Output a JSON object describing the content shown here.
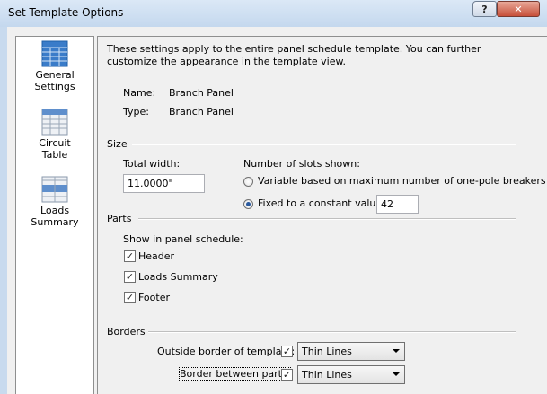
{
  "window": {
    "title": "Set Template Options",
    "help_label": "?",
    "close_label": "✕"
  },
  "nav": {
    "items": [
      {
        "line1": "General",
        "line2": "Settings",
        "icon": "grid-table-icon"
      },
      {
        "line1": "Circuit",
        "line2": "Table",
        "icon": "circuit-table-icon"
      },
      {
        "line1": "Loads",
        "line2": "Summary",
        "icon": "loads-summary-icon"
      }
    ]
  },
  "general": {
    "intro": "These settings apply to the entire panel schedule template. You can further customize the appearance in the template view.",
    "name_label": "Name:",
    "name_value": "Branch Panel",
    "type_label": "Type:",
    "type_value": "Branch Panel"
  },
  "size": {
    "heading": "Size",
    "total_width_label": "Total width:",
    "total_width_value": "11.0000\"",
    "slots_label": "Number of slots shown:",
    "option_variable": "Variable based on maximum number of one-pole breakers",
    "option_fixed": "Fixed to a constant value:",
    "fixed_value": "42"
  },
  "parts": {
    "heading": "Parts",
    "show_label": "Show in panel schedule:",
    "header_label": "Header",
    "loads_summary_label": "Loads Summary",
    "footer_label": "Footer",
    "checkmark": "✓"
  },
  "borders": {
    "heading": "Borders",
    "outside_label": "Outside border of template:",
    "outside_value": "Thin Lines",
    "between_label": "Border between parts:",
    "between_value": "Thin Lines"
  }
}
